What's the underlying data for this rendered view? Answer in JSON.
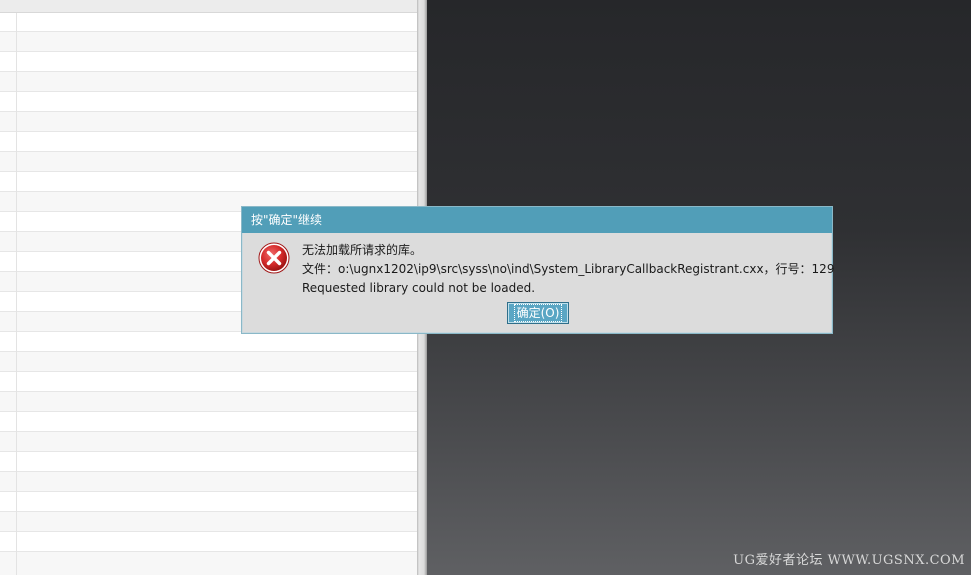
{
  "dialog": {
    "title": "按\"确定\"继续",
    "icon": "error-x-icon",
    "message_line1": "无法加载所请求的库。",
    "message_line2": "文件：o:\\ugnx1202\\ip9\\src\\syss\\no\\ind\\System_LibraryCallbackRegistrant.cxx，行号：129",
    "message_line3": "Requested library could not be loaded.",
    "ok_label": "确定(O)"
  },
  "watermark": {
    "text": "UG爱好者论坛 WWW.UGSNX.COM"
  },
  "colors": {
    "titlebar": "#519eb8",
    "dialog_bg": "#dcdcdc",
    "error_red": "#d42a2a",
    "graphics_bg_top": "#26272a",
    "graphics_bg_bottom": "#5f6063"
  }
}
